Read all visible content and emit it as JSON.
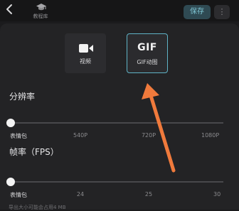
{
  "topbar": {
    "tutorial_label": "教程库",
    "save_label": "保存",
    "more_label": "⋮"
  },
  "formats": [
    {
      "label": "视频",
      "icon": "video-camera-icon",
      "selected": false
    },
    {
      "label": "GIF动图",
      "icon_text": "GIF",
      "selected": true
    }
  ],
  "resolution": {
    "title": "分辨率",
    "ticks": [
      "表情包",
      "540P",
      "720P",
      "1080P"
    ],
    "selected": "表情包"
  },
  "framerate": {
    "title": "帧率（FPS）",
    "ticks": [
      "表情包",
      "24",
      "25",
      "30"
    ],
    "selected": "表情包"
  },
  "note": "导出大小可能会占用4 MB",
  "colors": {
    "accent": "#5fb3c6",
    "arrow": "#f07a3c",
    "background": "#1b1b1d",
    "panel": "#232325"
  }
}
